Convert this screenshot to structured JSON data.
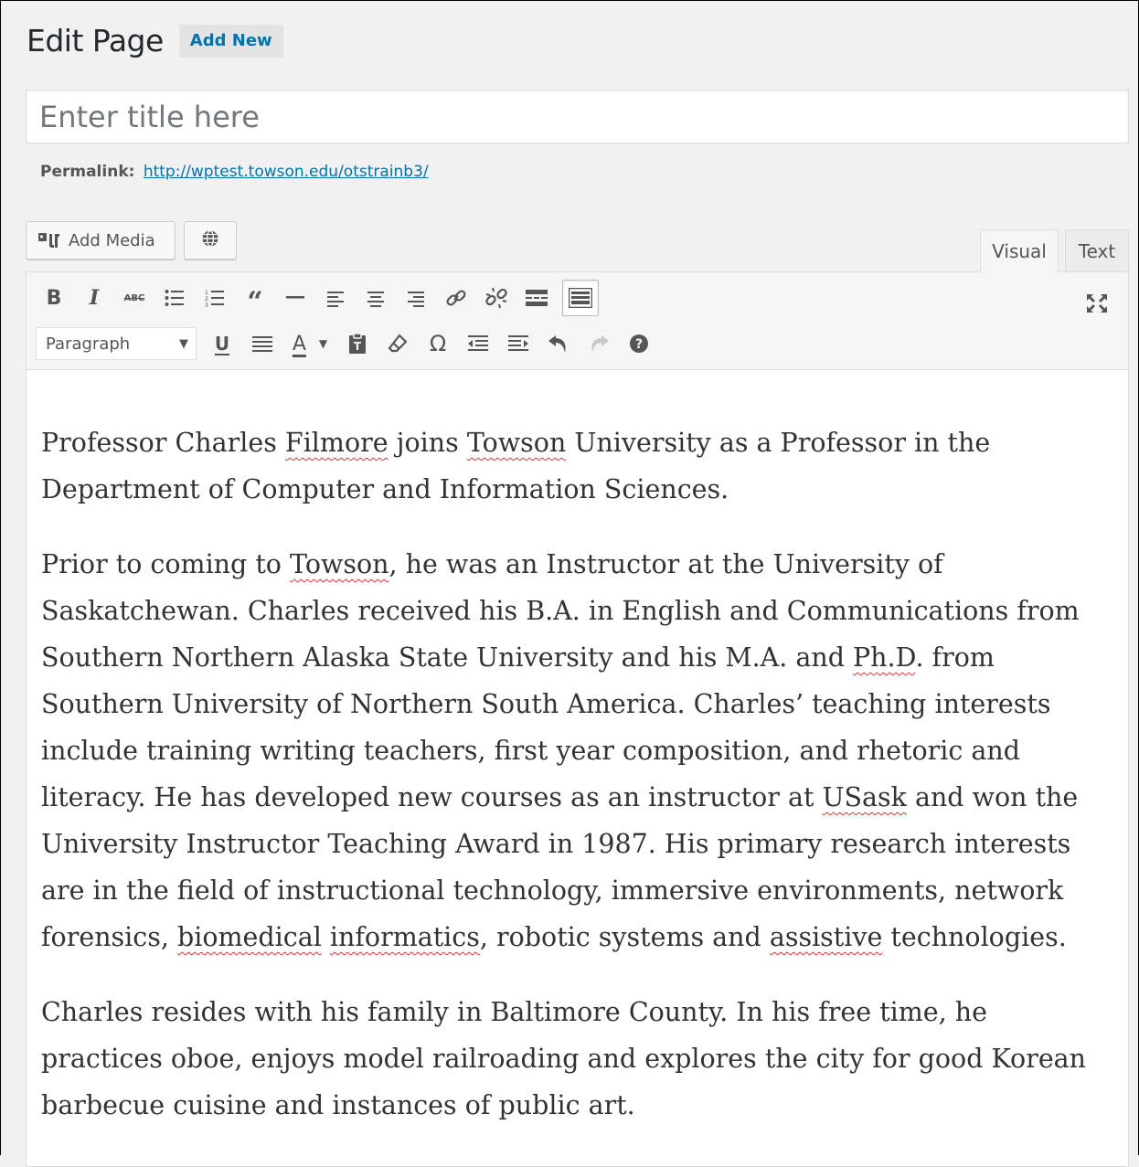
{
  "page": {
    "heading": "Edit Page",
    "add_new_label": "Add New"
  },
  "title_field": {
    "placeholder": "Enter title here",
    "value": ""
  },
  "permalink": {
    "label": "Permalink:",
    "url": "http://wptest.towson.edu/otstrainb3/"
  },
  "media_buttons": {
    "add_media_label": "Add Media",
    "add_media_icon": "add-media-icon",
    "globe_icon": "globe-icon"
  },
  "editor_tabs": {
    "visual": "Visual",
    "text": "Text",
    "active": "Visual"
  },
  "toolbar": {
    "row1_icons": [
      "bold-icon",
      "italic-icon",
      "strikethrough-icon",
      "bulleted-list-icon",
      "numbered-list-icon",
      "blockquote-icon",
      "horizontal-line-icon",
      "align-left-icon",
      "align-center-icon",
      "align-right-icon",
      "insert-link-icon",
      "remove-link-icon",
      "read-more-icon",
      "toolbar-toggle-icon"
    ],
    "format_select": "Paragraph",
    "row2_icons": [
      "underline-icon",
      "justify-icon",
      "text-color-icon",
      "paste-as-text-icon",
      "clear-formatting-icon",
      "special-character-icon",
      "outdent-icon",
      "indent-icon",
      "undo-icon",
      "redo-icon",
      "help-icon"
    ],
    "fullscreen_icon": "distraction-free-icon"
  },
  "content": {
    "p1": {
      "a": "Professor Charles ",
      "b": "Filmore",
      "c": " joins ",
      "d": "Towson",
      "e": " University as a Professor in the Department of Computer and Information Sciences."
    },
    "p2": {
      "a": "Prior to coming to ",
      "b": "Towson",
      "c": ", he was an Instructor at the University of Saskatchewan. Charles received his B.A. in English and Communications from Southern Northern Alaska State University and his M.A. and ",
      "d": "Ph.D",
      "e": ". from Southern University of Northern South America. Charles’ teaching interests include training writing teachers, first year composition, and rhetoric and literacy. He has developed new courses as an instructor at ",
      "f": "USask",
      "g": " and won the University Instructor Teaching Award in 1987. His primary research interests are in the field of instructional technology, immersive environments, network forensics, ",
      "h": "biomedical",
      "i": " ",
      "j": "informatics",
      "k": ", robotic systems and ",
      "l": "assistive",
      "m": " technologies."
    },
    "p3": "Charles resides with his family in Baltimore County. In his free time, he practices oboe, enjoys model railroading and explores the city for good Korean barbecue cuisine and instances of public art."
  },
  "colors": {
    "link": "#0073aa",
    "spell_underline": "#d63638",
    "background": "#f1f1f1"
  }
}
